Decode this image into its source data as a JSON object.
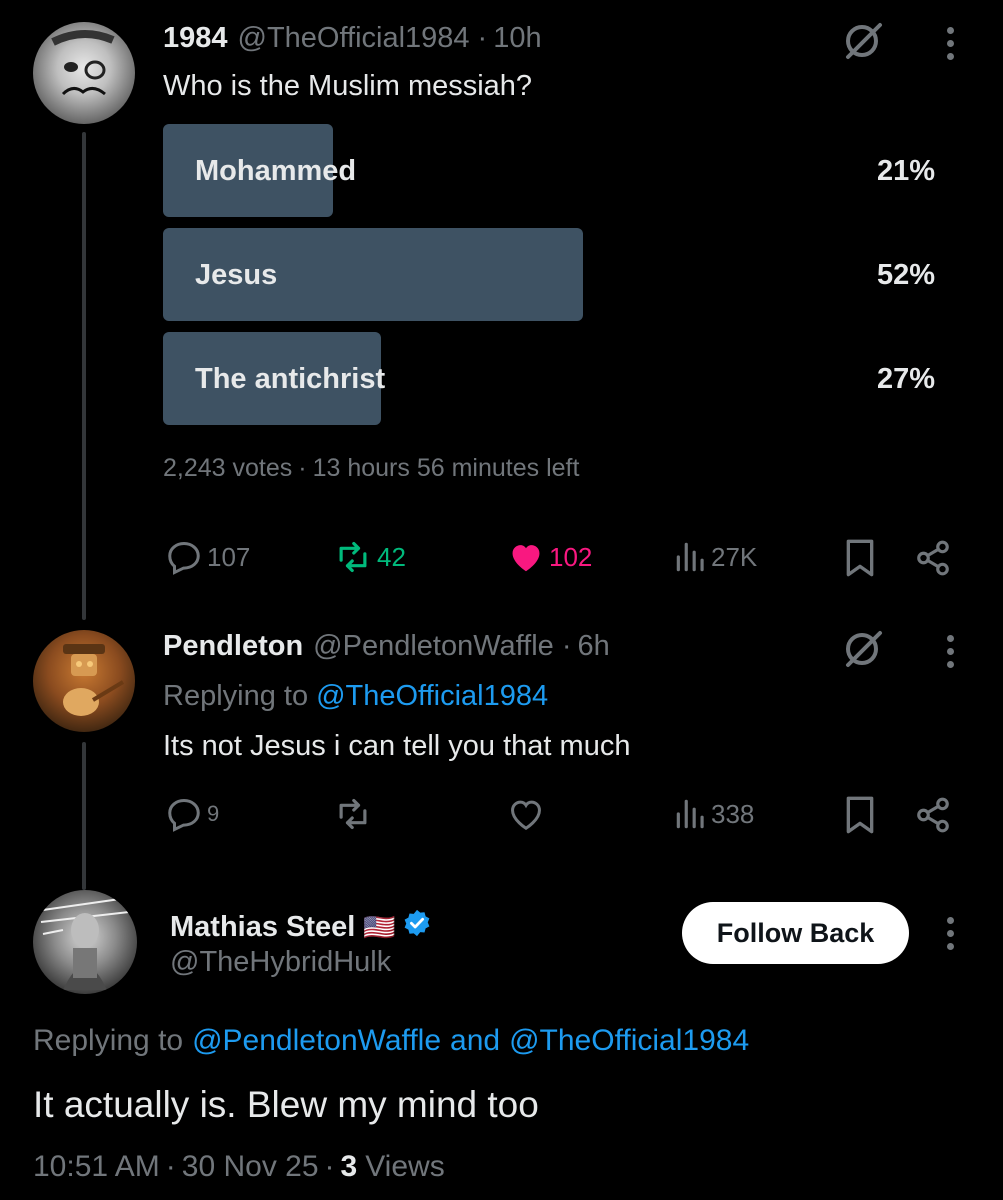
{
  "colors": {
    "background": "#000000",
    "text": "#e7e9ea",
    "muted": "#71767b",
    "link": "#1d9bf0",
    "repost": "#00ba7c",
    "like": "#f91880",
    "poll_bar": "#3e5263",
    "verified": "#1d9bf0"
  },
  "tweet1": {
    "name": "1984",
    "handle": "@TheOfficial1984",
    "sep": "·",
    "time": "10h",
    "text": "Who is the Muslim messiah?",
    "poll": {
      "options": [
        {
          "label": "Mohammed",
          "percent": "21%",
          "fraction": 0.21
        },
        {
          "label": "Jesus",
          "percent": "52%",
          "fraction": 0.52
        },
        {
          "label": "The  antichrist",
          "percent": "27%",
          "fraction": 0.27
        }
      ],
      "votes": "2,243 votes",
      "dot": "·",
      "time_left": "13 hours 56 minutes left"
    },
    "actions": {
      "replies": "107",
      "reposts": "42",
      "likes": "102",
      "views": "27K"
    }
  },
  "tweet2": {
    "name": "Pendleton",
    "handle": "@PendletonWaffle",
    "sep": "·",
    "time": "6h",
    "replying_prefix": "Replying to",
    "replying_to": "@TheOfficial1984",
    "text": "Its not Jesus i can tell you that much",
    "actions": {
      "replies": "9",
      "reposts": "",
      "likes": "",
      "views": "338"
    }
  },
  "tweet3": {
    "name": "Mathias Steel",
    "flag": "🇺🇸",
    "handle": "@TheHybridHulk",
    "follow_label": "Follow Back",
    "replying_prefix": "Replying to",
    "replying_to_1": "@PendletonWaffle",
    "and": "and",
    "replying_to_2": "@TheOfficial1984",
    "text": "It actually is. Blew my mind too",
    "time": "10:51 AM",
    "sep1": "·",
    "date": "30 Nov 25",
    "sep2": "·",
    "views_count": "3",
    "views_label": "Views"
  },
  "icons": [
    "grok-icon",
    "more-icon",
    "reply-icon",
    "repost-icon",
    "like-icon",
    "views-icon",
    "bookmark-icon",
    "share-icon",
    "verified-badge-icon"
  ]
}
